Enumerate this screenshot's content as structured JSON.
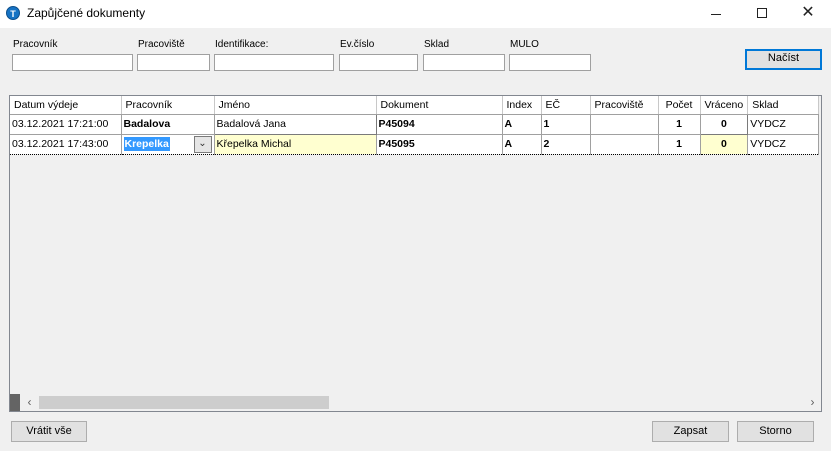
{
  "window": {
    "title": "Zapůjčené dokumenty",
    "icon": "app-logo-icon",
    "controls": {
      "minimize": "minimize-icon",
      "maximize": "maximize-icon",
      "close": "✕"
    }
  },
  "filters": [
    {
      "label": "Pracovník",
      "value": ""
    },
    {
      "label": "Pracoviště",
      "value": ""
    },
    {
      "label": "Identifikace:",
      "value": ""
    },
    {
      "label": "Ev.číslo",
      "value": ""
    },
    {
      "label": "Sklad",
      "value": ""
    },
    {
      "label": "MULO",
      "value": ""
    }
  ],
  "buttons": {
    "load": "Načíst",
    "return_all": "Vrátit vše",
    "save": "Zapsat",
    "cancel": "Storno"
  },
  "grid": {
    "columns": [
      "Datum výdeje",
      "Pracovník",
      "Jméno",
      "Dokument",
      "Index",
      "EČ",
      "Pracoviště",
      "Počet",
      "Vráceno",
      "Sklad"
    ],
    "rows": [
      {
        "datum": "03.12.2021 17:21:00",
        "pracovnik": "Badalova",
        "jmeno": "Badalová Jana",
        "dokument": "P45094",
        "index": "A",
        "ec": "1",
        "pracoviste": "",
        "pocet": "1",
        "vraceno": "0",
        "sklad": "VYDCZ"
      },
      {
        "datum": "03.12.2021 17:43:00",
        "pracovnik": "Krepelka",
        "jmeno": "Křepelka Michal",
        "dokument": "P45095",
        "index": "A",
        "ec": "2",
        "pracoviste": "",
        "pocet": "1",
        "vraceno": "0",
        "sklad": "VYDCZ"
      }
    ]
  },
  "scrollbar": {
    "left_arrow": "‹",
    "right_arrow": "›"
  },
  "colors": {
    "selection": "#3399ff",
    "edit_cell": "#ffffd0",
    "default_button_border": "#0078d7",
    "app_icon": "#1673c4"
  }
}
